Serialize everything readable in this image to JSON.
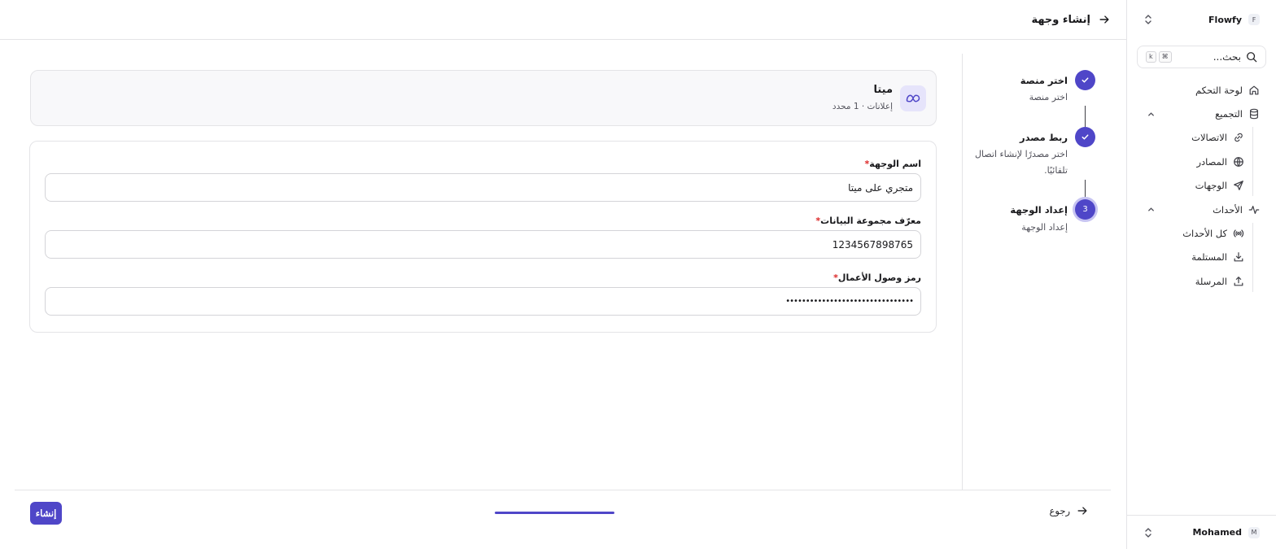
{
  "sidebar": {
    "workspace": {
      "name": "Flowfy",
      "badge": "F"
    },
    "search": {
      "placeholder": "بحث...",
      "kbd_mod": "⌘",
      "kbd_key": "k"
    },
    "items": [
      {
        "label": "لوحة التحكم",
        "icon": "home-icon"
      },
      {
        "label": "التجميع",
        "icon": "database-icon",
        "expanded": true,
        "children": [
          {
            "label": "الاتصالات",
            "icon": "link-icon"
          },
          {
            "label": "المصادر",
            "icon": "globe-icon"
          },
          {
            "label": "الوجهات",
            "icon": "send-icon"
          }
        ]
      },
      {
        "label": "الأحداث",
        "icon": "activity-icon",
        "expanded": true,
        "children": [
          {
            "label": "كل الأحداث",
            "icon": "broadcast-icon"
          },
          {
            "label": "المستلمة",
            "icon": "download-icon"
          },
          {
            "label": "المرسلة",
            "icon": "upload-icon"
          }
        ]
      }
    ],
    "user": {
      "name": "Mohamed",
      "badge": "M"
    }
  },
  "header": {
    "title": "إنشاء وجهة"
  },
  "steps": [
    {
      "title": "اختر منصة",
      "desc": "اختر منصة",
      "state": "done"
    },
    {
      "title": "ربط مصدر",
      "desc": "اختر مصدرًا لإنشاء اتصال تلقائيًا.",
      "state": "done"
    },
    {
      "number": "3",
      "title": "إعداد الوجهة",
      "desc": "إعداد الوجهة",
      "state": "active"
    }
  ],
  "platform": {
    "name": "ميتا",
    "subtitle": "إعلانات · 1 محدد",
    "icon": "meta-icon"
  },
  "form": {
    "destination_name": {
      "label": "اسم الوجهة",
      "required": "*",
      "value": "متجري على ميتا"
    },
    "dataset_id": {
      "label": "معرّف مجموعة البيانات",
      "required": "*",
      "value": "1234567898765"
    },
    "access_token": {
      "label": "رمز وصول الأعمال",
      "required": "*",
      "value": "••••••••••••••••••••••••••••••••"
    }
  },
  "footer": {
    "back_label": "رجوع",
    "create_label": "إنشاء",
    "progress": 1.0
  },
  "colors": {
    "accent": "#4f46c8",
    "border": "#e4e4e7",
    "required": "#dc2626"
  }
}
